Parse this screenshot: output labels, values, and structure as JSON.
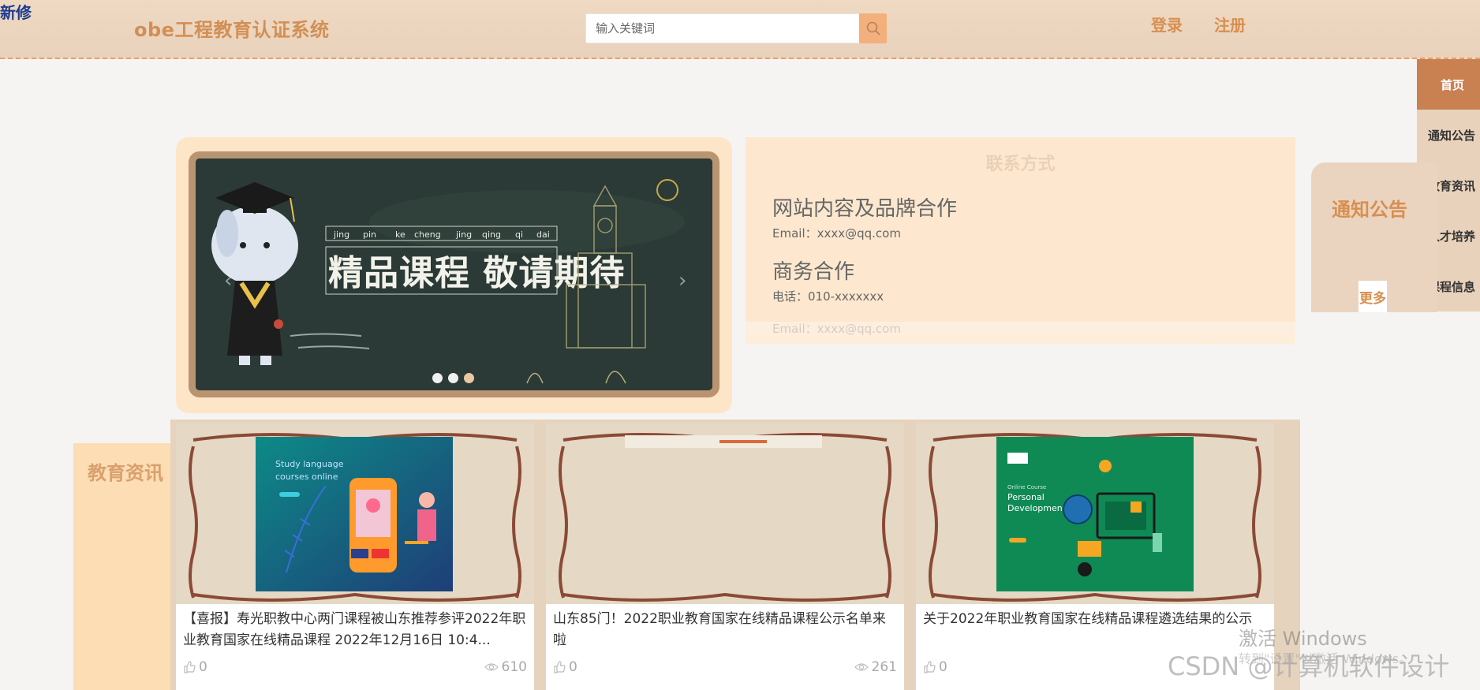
{
  "header": {
    "corner_tag": "新修",
    "site_title": "obe工程教育认证系统",
    "search_placeholder": "输入关键词",
    "login": "登录",
    "register": "注册"
  },
  "side_nav": {
    "items": [
      {
        "label": "首页",
        "active": true
      },
      {
        "label": "通知公告",
        "active": false
      },
      {
        "label": "教育资讯",
        "active": false
      },
      {
        "label": "人才培养",
        "active": false
      },
      {
        "label": "课程信息",
        "active": false
      }
    ]
  },
  "carousel": {
    "pinyin": [
      "jing",
      "pin",
      "ke",
      "cheng",
      "jing",
      "qing",
      "qi",
      "dai"
    ],
    "headline": "精品课程 敬请期待",
    "slide_count": 3,
    "active_index": 1
  },
  "contact": {
    "title": "联系方式",
    "section1_heading": "网站内容及品牌合作",
    "section1_line": "Email：xxxx@qq.com",
    "section2_heading": "商务合作",
    "section2_line": "电话：010-xxxxxxx",
    "section3_line": "Email：xxxx@qq.com"
  },
  "notice": {
    "title": "通知公告",
    "more": "更多"
  },
  "education": {
    "title": "教育资讯",
    "cards": [
      {
        "title": "【喜报】寿光职教中心两门课程被山东推荐参评2022年职业教育国家在线精品课程 2022年12月16日 10:4...",
        "likes": "0",
        "views": "610",
        "image": "study-language-illustration",
        "image_text_1": "Study language",
        "image_text_2": "courses online"
      },
      {
        "title": "山东85门！2022职业教育国家在线精品课程公示名单来啦",
        "likes": "0",
        "views": "261",
        "image": "blank-frame"
      },
      {
        "title": "关于2022年职业教育国家在线精品课程遴选结果的公示",
        "likes": "0",
        "views": "",
        "image": "personal-development-illustration",
        "image_text_1": "Online Course",
        "image_text_2": "Personal",
        "image_text_3": "Development"
      }
    ]
  },
  "watermarks": {
    "windows_1": "激活 Windows",
    "windows_2": "转到\"设置\"以激活 Windows。",
    "csdn": "CSDN @计算机软件设计"
  },
  "colors": {
    "brand": "#d88f4f",
    "header_bg": "#e8d2bb",
    "nav_active": "#c98152",
    "panel_peach": "#fde8cf"
  }
}
